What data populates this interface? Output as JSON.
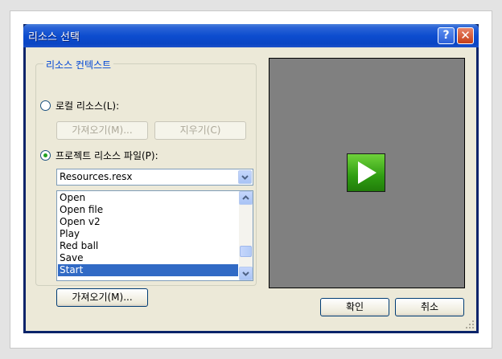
{
  "window": {
    "title": "리소스 선택",
    "help_icon": "question-mark-icon",
    "close_icon": "close-x-icon",
    "titlebar_color": "#0a4bcf",
    "face_color": "#ece9d8"
  },
  "group": {
    "legend": "리소스 컨텍스트",
    "local_radio_label": "로컬 리소스(L):",
    "local_radio_checked": false,
    "import_button_disabled": "가져오기(M)...",
    "clear_button": "지우기(C)",
    "project_radio_label": "프로젝트 리소스 파일(P):",
    "project_radio_checked": true,
    "resource_file_value": "Resources.resx",
    "import_button": "가져오기(M)..."
  },
  "resource_list": {
    "items": [
      "Open",
      "Open file",
      "Open v2",
      "Play",
      "Red ball",
      "Save",
      "Start"
    ],
    "selected": "Start",
    "selected_color": "#316ac5"
  },
  "preview": {
    "background": "#808080",
    "icon": "green-play-icon"
  },
  "footer": {
    "ok_button": "확인",
    "cancel_button": "취소"
  }
}
